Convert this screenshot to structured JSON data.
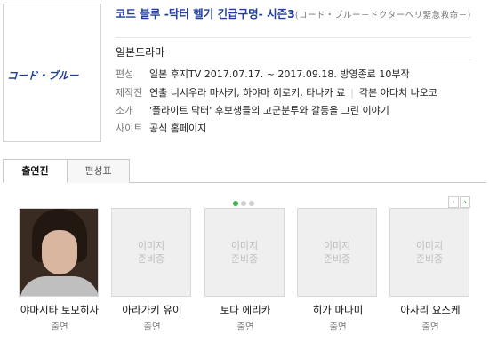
{
  "poster": {
    "logo_text": "コード・ブルー"
  },
  "title": {
    "main": "코드 블루 -닥터 헬기 긴급구명- 시즌3",
    "sub": "(コード・ブルー－ドクターヘリ緊急救命－)"
  },
  "genre": "일본드라마",
  "info": {
    "broadcast_label": "편성",
    "broadcast_value": "일본 후지TV 2017.07.17. ~ 2017.09.18. 방영종료 10부작",
    "production_label": "제작진",
    "production_director": "연출 니시우라 마사키, 하야마 히로키, 타나카 료",
    "production_writer": "각본 아다치 나오코",
    "intro_label": "소개",
    "intro_value": "'플라이트 닥터' 후보생들의 고군분투와 갈등을 그린 이야기",
    "site_label": "사이트",
    "site_value": "공식 홈페이지"
  },
  "tabs": {
    "cast": "출연진",
    "schedule": "편성표"
  },
  "pager": {
    "prev": "‹",
    "next": "›"
  },
  "placeholder": {
    "line1": "이미지",
    "line2": "준비중"
  },
  "cast": [
    {
      "name": "야마시타 토모히사",
      "role": "출연",
      "has_photo": true
    },
    {
      "name": "아라가키 유이",
      "role": "출연",
      "has_photo": false
    },
    {
      "name": "토다 에리카",
      "role": "출연",
      "has_photo": false
    },
    {
      "name": "히가 마나미",
      "role": "출연",
      "has_photo": false
    },
    {
      "name": "아사리 요스케",
      "role": "출연",
      "has_photo": false
    }
  ]
}
